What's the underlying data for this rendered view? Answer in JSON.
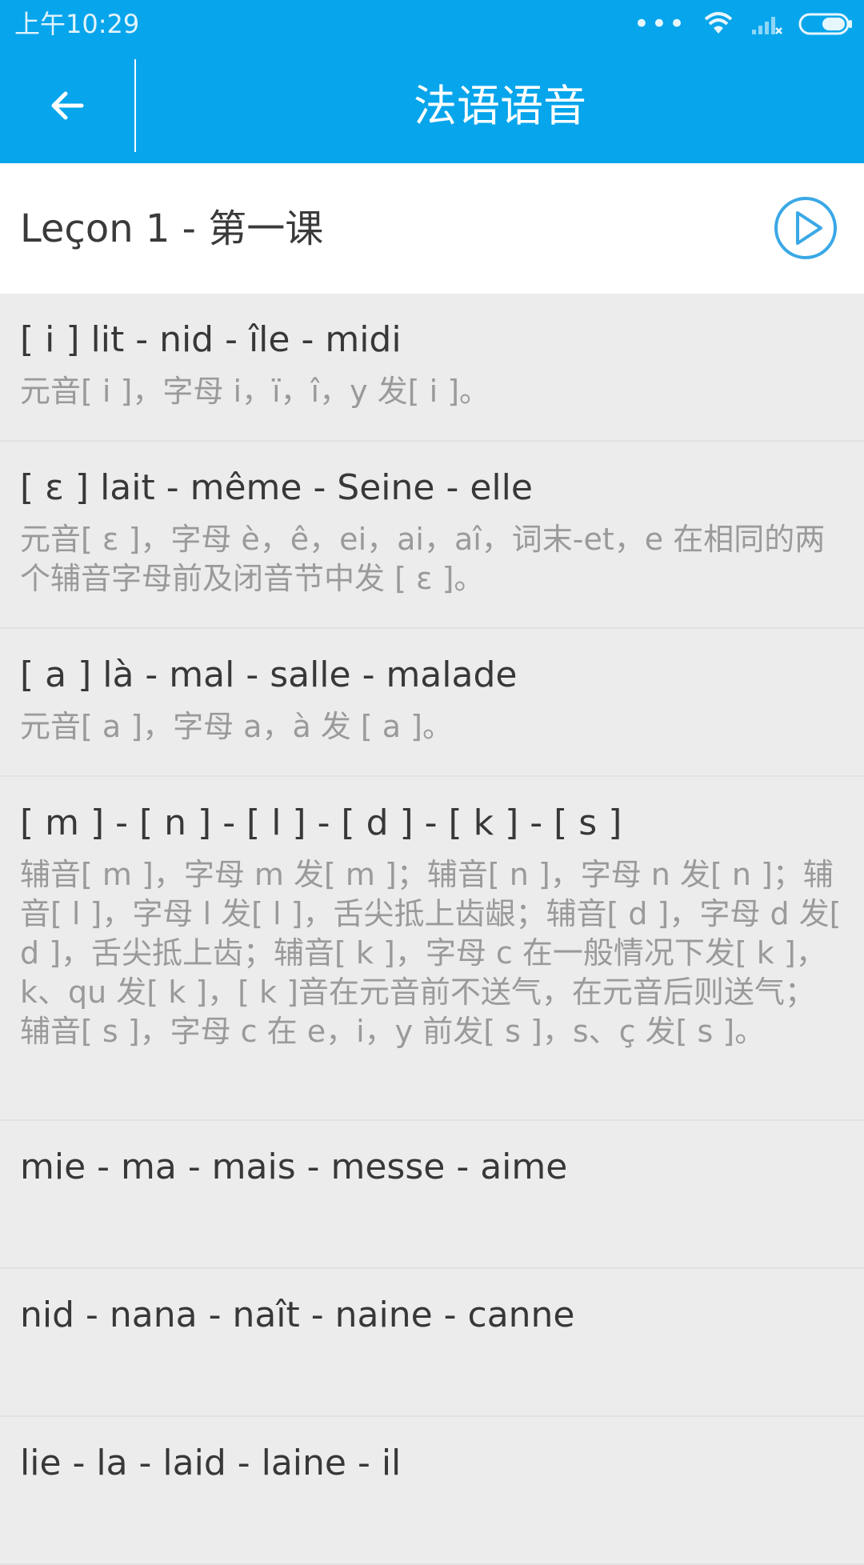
{
  "status_bar": {
    "time": "上午10:29",
    "icons": [
      "more-dots-icon",
      "wifi-icon",
      "signal-icon",
      "battery-icon"
    ]
  },
  "app_bar": {
    "title": "法语语音",
    "back_icon": "back-arrow-icon"
  },
  "lesson": {
    "title": "Leçon 1 - 第一课",
    "play_icon": "play-circle-icon"
  },
  "items": [
    {
      "title": "[ i ] lit - nid - île - midi",
      "desc": "元音[ i ]，字母 i，ï，î，y 发[ i ]。"
    },
    {
      "title": "[ ε ] lait - même - Seine - elle",
      "desc": "元音[ ε ]，字母 è，ê，ei，ai，aî，词末-et，e 在相同的两个辅音字母前及闭音节中发 [ ε ]。"
    },
    {
      "title": "[ a ] là - mal - salle - malade",
      "desc": "元音[ a ]，字母 a，à 发 [ a ]。"
    },
    {
      "title": "[ m ] - [ n ] - [ l ] - [ d ] - [ k ] - [ s ]",
      "desc": "辅音[ m ]，字母 m 发[ m ]；辅音[ n ]，字母 n 发[ n ]；辅音[ l ]，字母 l 发[ l ]，舌尖抵上齿龈；辅音[ d ]，字母 d 发[ d ]，舌尖抵上齿；辅音[ k ]，字母 c 在一般情况下发[ k ]，k、qu 发[ k ]，[ k ]音在元音前不送气，在元音后则送气；辅音[ s ]，字母 c 在 e，i，y 前发[ s ]，s、ç 发[ s ]。"
    },
    {
      "title": "mie - ma - mais - messe - aime",
      "desc": ""
    },
    {
      "title": "nid - nana - naît - naine - canne",
      "desc": ""
    },
    {
      "title": "lie - la - laid - laine - il",
      "desc": ""
    }
  ],
  "colors": {
    "primary": "#06a5ec",
    "background": "#ececec",
    "title_text": "#383838",
    "desc_text": "#9a9a9a",
    "play_icon": "#3aa8e6"
  }
}
